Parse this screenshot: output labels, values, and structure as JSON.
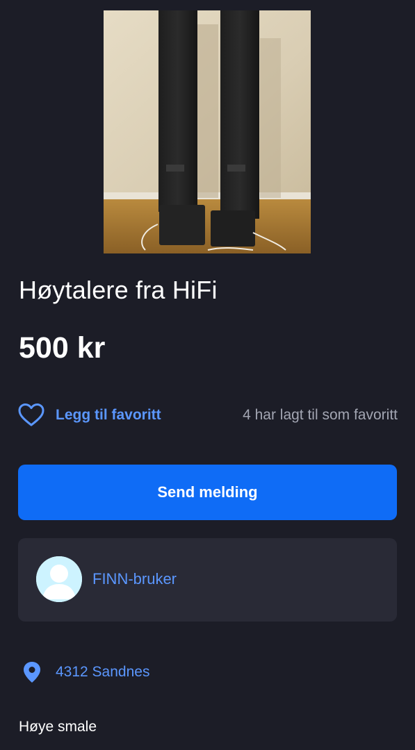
{
  "listing": {
    "title": "Høytalere fra HiFi",
    "price": "500 kr",
    "description": "Høye smale"
  },
  "favorite": {
    "label": "Legg til favoritt",
    "count_text": "4 har lagt til som favoritt",
    "icon": "heart-outline-icon"
  },
  "actions": {
    "send_message_label": "Send melding"
  },
  "seller": {
    "name": "FINN-bruker",
    "avatar_icon": "user-avatar-icon"
  },
  "location": {
    "label": "4312 Sandnes",
    "icon": "map-pin-icon"
  },
  "colors": {
    "background": "#1c1d27",
    "card": "#292a36",
    "primary": "#0f6cf6",
    "link": "#5b97ff",
    "muted": "#a3a6b3"
  }
}
